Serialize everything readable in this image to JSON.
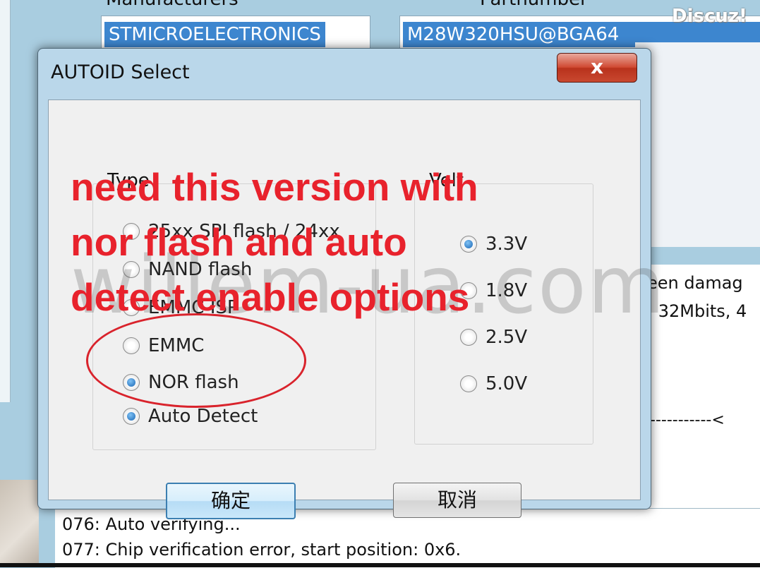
{
  "watermark": {
    "top": "Discuz!",
    "center": "willem-ua.com"
  },
  "background": {
    "manufacturers_header": "Manufacturers",
    "partnumber_header": "Partnumber",
    "manufacturer_selected": "STMICROELECTRONICS",
    "partnumber_selected": "M28W320HSU@BGA64",
    "side_log": [
      "een damag",
      ": 32Mbits, 4"
    ],
    "dash_line": "-----------<"
  },
  "log": {
    "lines": [
      "076:  Auto verifying...",
      "077:  Chip verification error, start position: 0x6."
    ]
  },
  "dialog": {
    "title": "AUTOID Select",
    "close_label": "x",
    "type_group": {
      "label": "Type",
      "options": [
        {
          "label": "25xx SPI flash / 24xx",
          "checked": false
        },
        {
          "label": "NAND flash",
          "checked": false
        },
        {
          "label": "EMMC ISP",
          "checked": false
        },
        {
          "label": "EMMC",
          "checked": false
        },
        {
          "label": "NOR flash",
          "checked": true
        },
        {
          "label": "Auto Detect",
          "checked": true
        }
      ]
    },
    "volt_group": {
      "label": "Volt",
      "options": [
        {
          "label": "3.3V",
          "checked": true
        },
        {
          "label": "1.8V",
          "checked": false
        },
        {
          "label": "2.5V",
          "checked": false
        },
        {
          "label": "5.0V",
          "checked": false
        }
      ]
    },
    "ok_label": "确定",
    "cancel_label": "取消"
  },
  "annotation": {
    "lines": [
      "need this version with",
      "nor flash and auto",
      "detect enable options"
    ],
    "color": "#e8222c"
  }
}
